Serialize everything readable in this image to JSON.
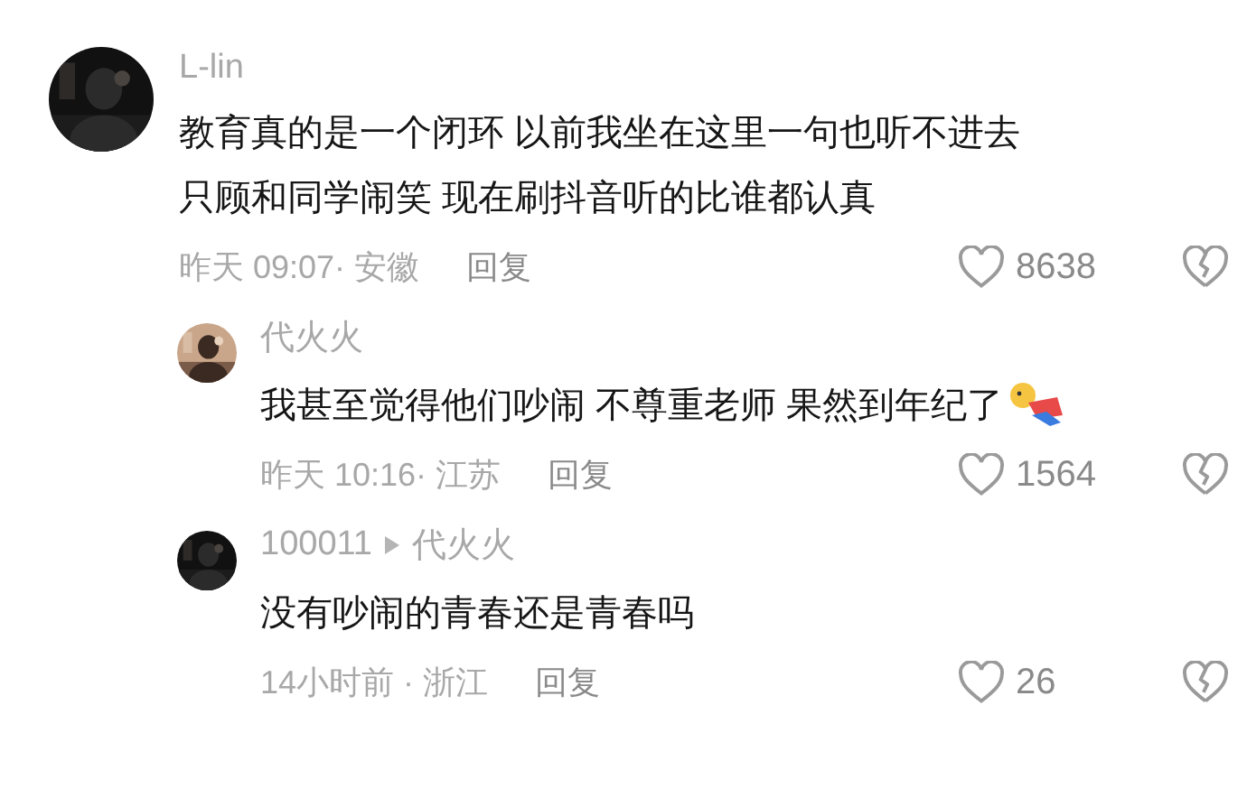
{
  "comments": [
    {
      "kind": "top",
      "author": "L-lin",
      "text": "教育真的是一个闭环 以前我坐在这里一句也听不进去只顾和同学闹笑 现在刷抖音听的比谁都认真",
      "meta": "昨天 09:07· 安徽",
      "reply": "回复",
      "likes": "8638",
      "emoji": false
    },
    {
      "kind": "reply",
      "author": "代火火",
      "text": "我甚至觉得他们吵闹 不尊重老师 果然到年纪了",
      "meta": "昨天 10:16· 江苏",
      "reply": "回复",
      "likes": "1564",
      "emoji": true
    },
    {
      "kind": "reply",
      "author": "100011",
      "reply_to": "代火火",
      "text": "没有吵闹的青春还是青春吗",
      "meta": "14小时前 · 浙江",
      "reply": "回复",
      "likes": "26",
      "emoji": false
    }
  ]
}
